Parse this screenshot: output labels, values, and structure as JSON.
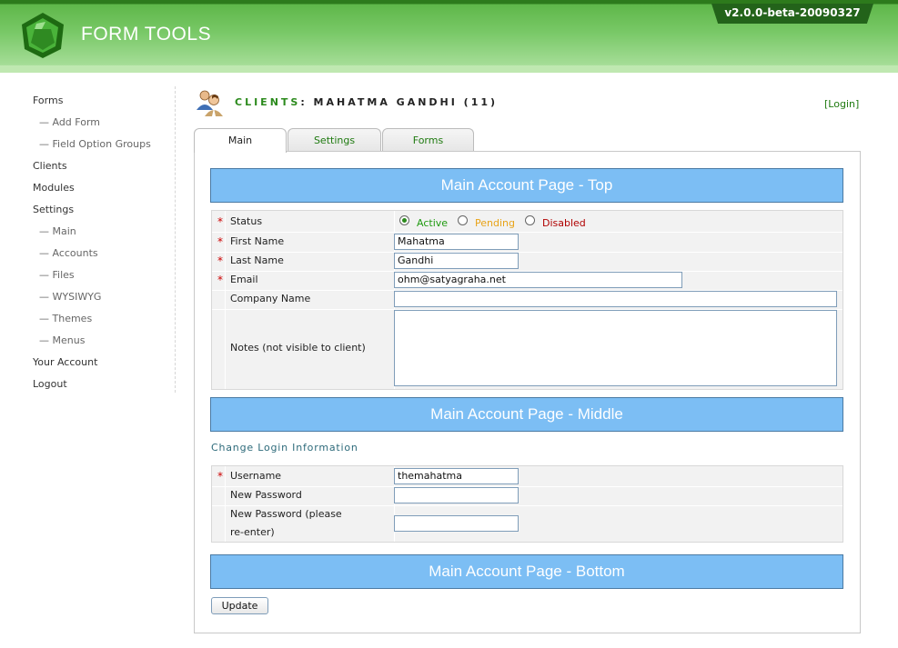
{
  "app": {
    "brand": "FORM TOOLS",
    "version": "v2.0.0-beta-20090327"
  },
  "sidebar": {
    "items": [
      {
        "label": "Forms"
      },
      {
        "label": "— Add Form"
      },
      {
        "label": "— Field Option Groups"
      },
      {
        "label": "Clients"
      },
      {
        "label": "Modules"
      },
      {
        "label": "Settings"
      },
      {
        "label": "— Main"
      },
      {
        "label": "— Accounts"
      },
      {
        "label": "— Files"
      },
      {
        "label": "— WYSIWYG"
      },
      {
        "label": "— Themes"
      },
      {
        "label": "— Menus"
      },
      {
        "label": "Your Account"
      },
      {
        "label": "Logout"
      }
    ]
  },
  "page": {
    "title_label": "CLIENTS",
    "title_value": ": MAHATMA GANDHI (11)",
    "login_link": "[Login]"
  },
  "tabs": [
    {
      "label": "Main",
      "active": true
    },
    {
      "label": "Settings",
      "active": false
    },
    {
      "label": "Forms",
      "active": false
    }
  ],
  "sections": {
    "top": "Main Account Page - Top",
    "middle": "Main Account Page - Middle",
    "bottom": "Main Account Page - Bottom"
  },
  "form_top": {
    "status": {
      "label": "Status",
      "options": [
        {
          "label": "Active",
          "color": "#1f9a10",
          "selected": true
        },
        {
          "label": "Pending",
          "color": "#e8a317",
          "selected": false
        },
        {
          "label": "Disabled",
          "color": "#b00000",
          "selected": false
        }
      ]
    },
    "first_name": {
      "label": "First Name",
      "value": "Mahatma"
    },
    "last_name": {
      "label": "Last Name",
      "value": "Gandhi"
    },
    "email": {
      "label": "Email",
      "value": "ohm@satyagraha.net"
    },
    "company": {
      "label": "Company Name",
      "value": ""
    },
    "notes": {
      "label": "Notes (not visible to client)",
      "value": ""
    }
  },
  "login_section": {
    "heading": "Change Login Information",
    "username": {
      "label": "Username",
      "value": "themahatma"
    },
    "new_password": {
      "label": "New Password",
      "value": ""
    },
    "reenter_line1": "New Password (please",
    "reenter_line2": "re-enter)"
  },
  "buttons": {
    "update": "Update"
  },
  "required_mark": "*"
}
